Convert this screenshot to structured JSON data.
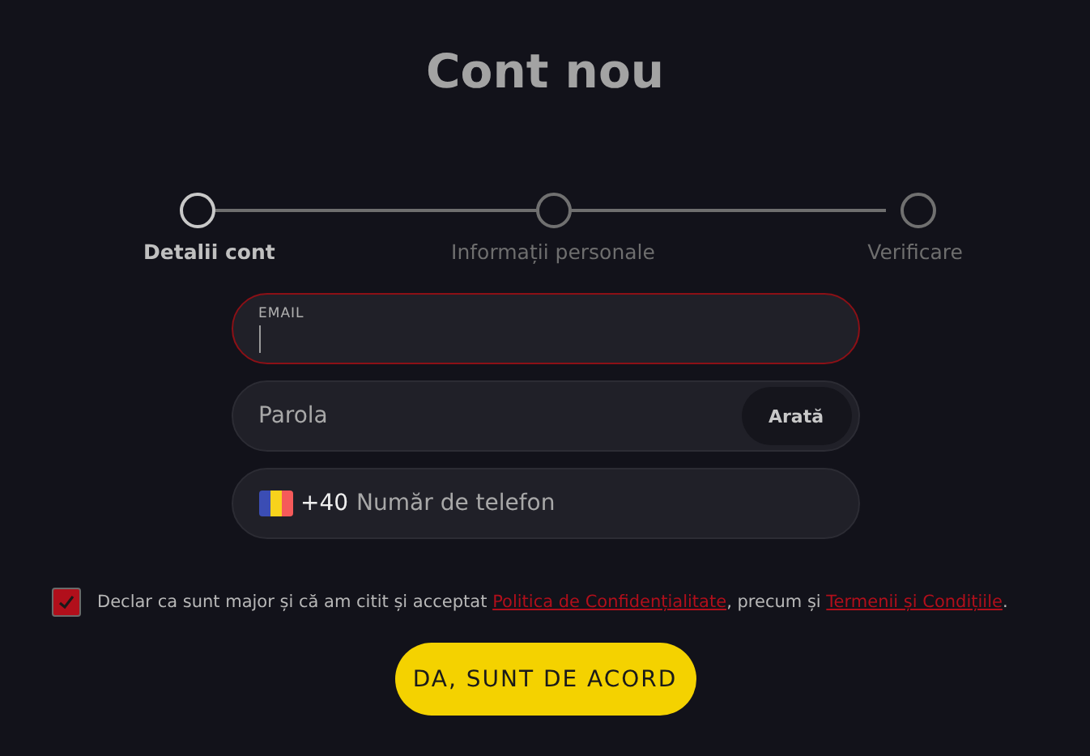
{
  "title": "Cont nou",
  "steps": [
    {
      "label": "Detalii cont",
      "selected": true
    },
    {
      "label": "Informații personale",
      "selected": false
    },
    {
      "label": "Verificare",
      "selected": false
    }
  ],
  "email": {
    "label": "EMAIL",
    "error": true
  },
  "password": {
    "placeholder": "Parola",
    "show_button": "Arată"
  },
  "phone": {
    "prefix": "+40",
    "placeholder": "Număr de telefon"
  },
  "consent": {
    "checked": true,
    "text_before": "Declar ca sunt major și că am citit și acceptat",
    "link_1": "Politica de Confidențialitate",
    "text_middle": ", precum și",
    "link_2": "Termenii și Condițiile",
    "text_after": "."
  },
  "submit": "DA, SUNT DE ACORD"
}
